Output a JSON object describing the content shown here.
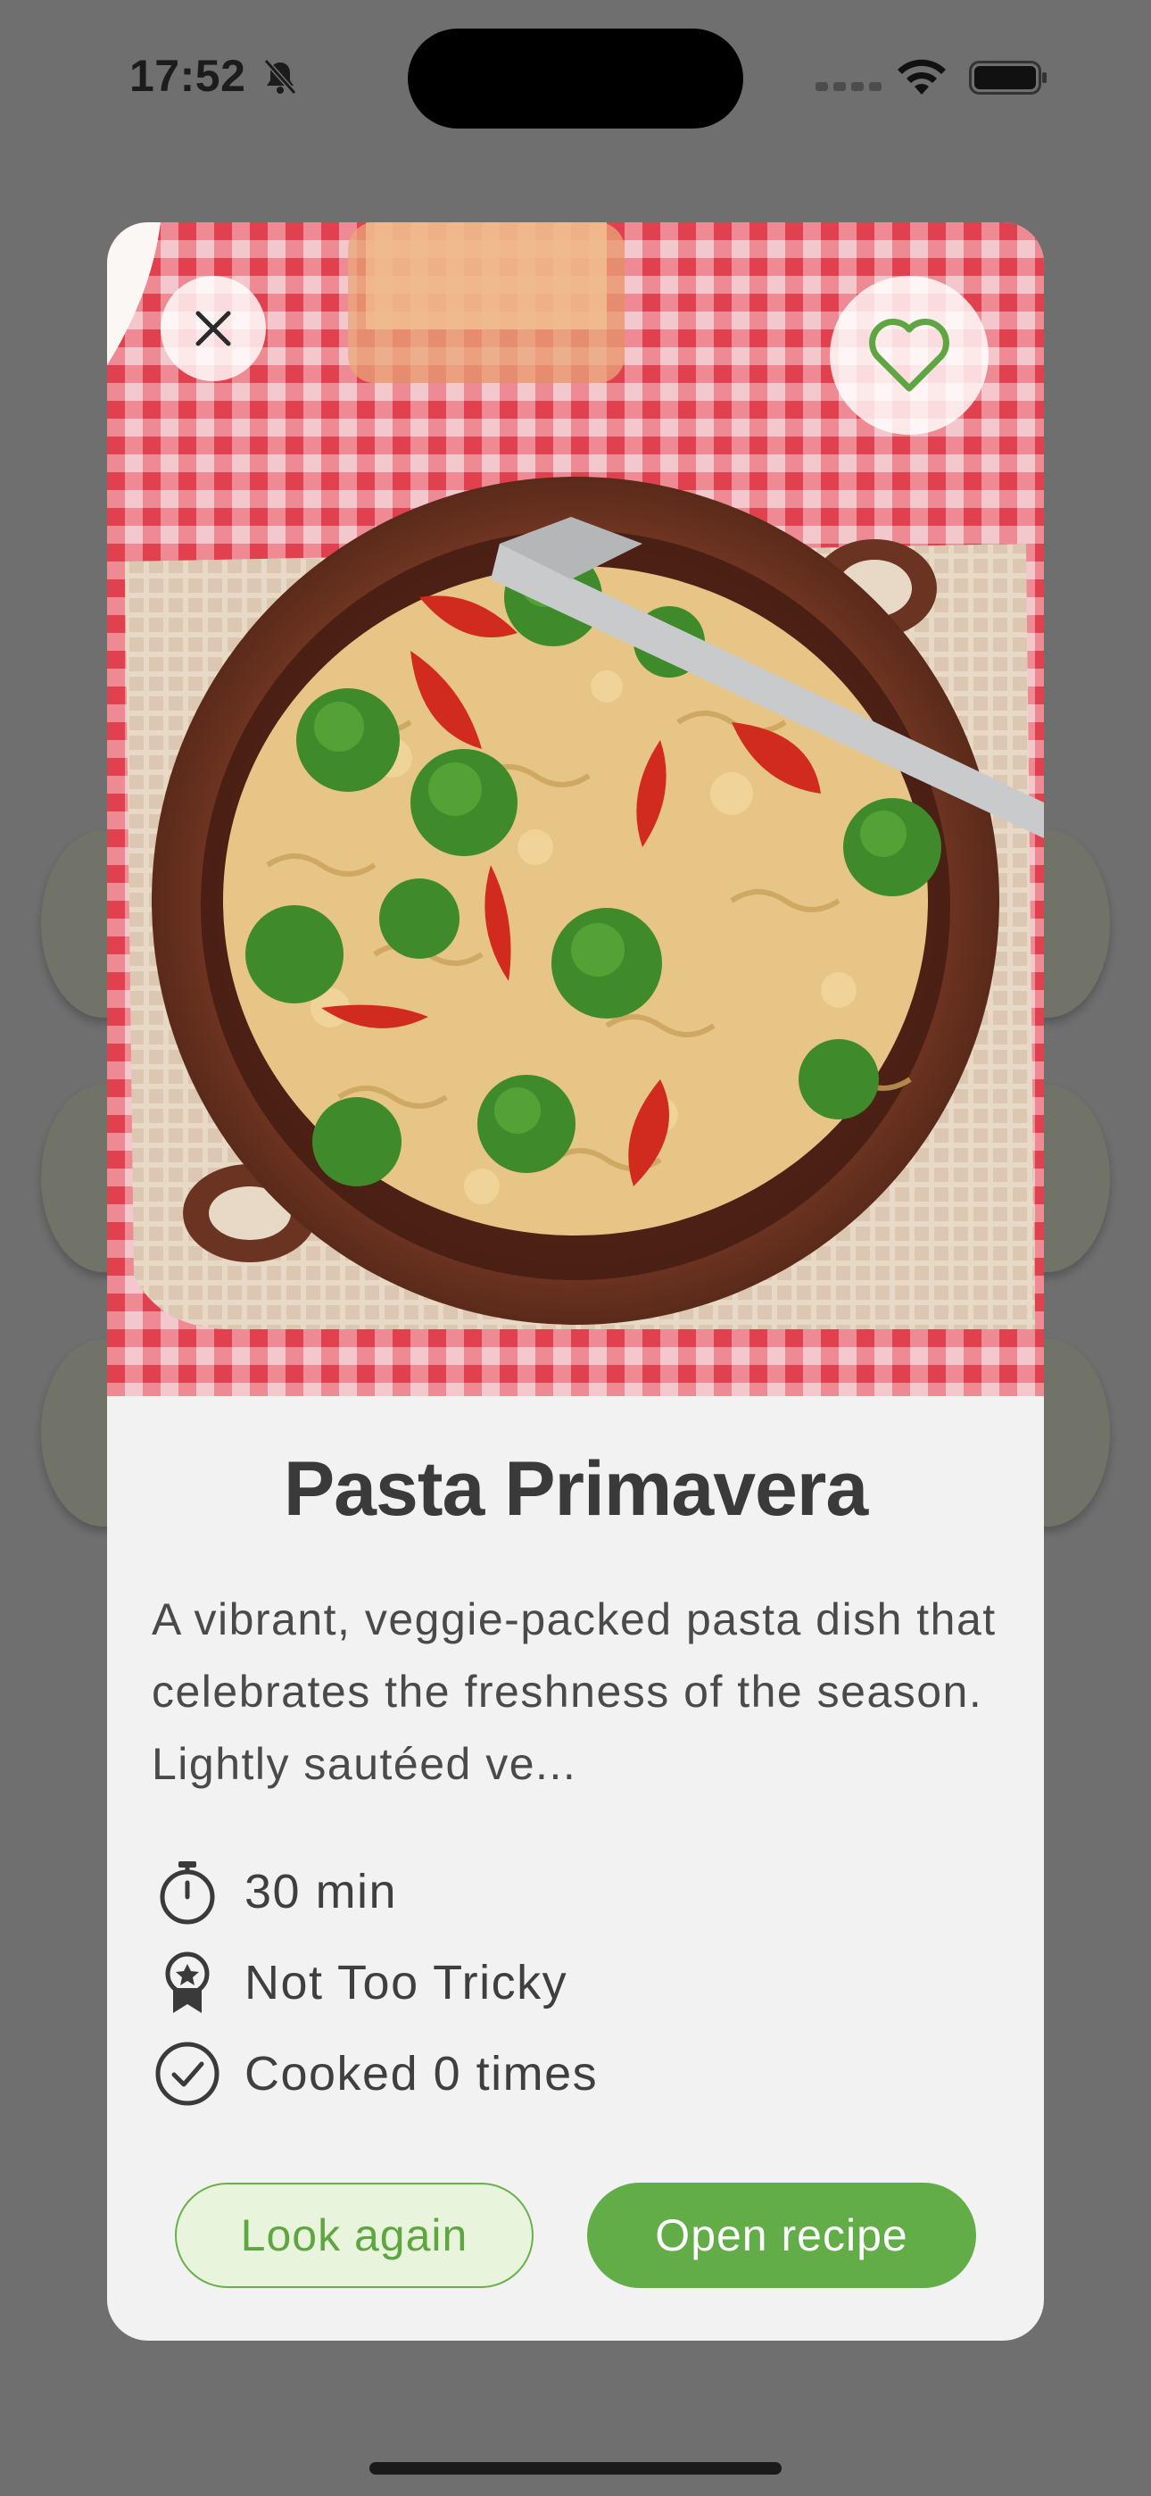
{
  "status_bar": {
    "time": "17:52",
    "silent_icon": "bell-slash-icon",
    "wifi_icon": "wifi-icon",
    "battery_icon": "battery-full-icon"
  },
  "modal": {
    "close_icon": "close-icon",
    "favorite_icon": "heart-outline-icon",
    "image_subject": "pasta-bowl-photo",
    "title": "Pasta Primavera",
    "description": "A vibrant, veggie-packed pasta dish that celebrates the freshness of the season. Lightly sautéed ve...",
    "meta": {
      "time": "30 min",
      "difficulty": "Not Too Tricky",
      "cooked": "Cooked 0 times"
    },
    "buttons": {
      "look_again": "Look again",
      "open_recipe": "Open recipe"
    }
  },
  "colors": {
    "accent_green": "#62ad47",
    "light_green_bg": "#e8f5dc",
    "overlay": "#6f6f6f",
    "card_bg": "#f2f2f2"
  }
}
